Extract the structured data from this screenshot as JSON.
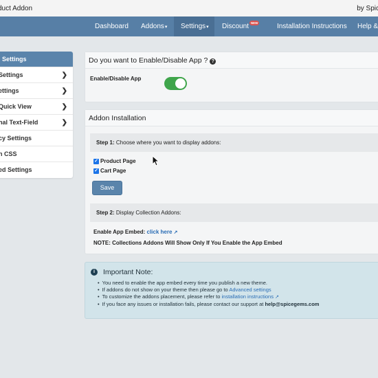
{
  "app": {
    "title": "duct Addon",
    "by": "by Spic"
  },
  "nav": {
    "dashboard": "Dashboard",
    "addons": "Addons",
    "settings": "Settings",
    "discount": "Discount",
    "discount_badge": "NEW",
    "installation": "Installation Instructions",
    "help": "Help &"
  },
  "sidebar": {
    "items": [
      {
        "label": "l Settings",
        "active": true,
        "chevron": false
      },
      {
        "label": "Settings",
        "chevron": true
      },
      {
        "label": "ettings",
        "chevron": true
      },
      {
        "label": "Quick View",
        "chevron": true
      },
      {
        "label": "nal Text-Field",
        "chevron": true
      },
      {
        "label": "cy Settings",
        "chevron": false
      },
      {
        "label": "n CSS",
        "chevron": false
      },
      {
        "label": "ed Settings",
        "chevron": false
      }
    ]
  },
  "enable_panel": {
    "title": "Do you want to Enable/Disable App ?",
    "label": "Enable/Disable App",
    "enabled": true
  },
  "install_panel": {
    "title": "Addon Installation",
    "step1_prefix": "Step 1:",
    "step1_text": "Choose where you want to display addons:",
    "checkboxes": [
      {
        "label": "Product Page",
        "checked": true
      },
      {
        "label": "Cart Page",
        "checked": true
      }
    ],
    "save_label": "Save",
    "step2_prefix": "Step 2:",
    "step2_text": "Display Collection Addons:",
    "embed_label": "Enable App Embed:",
    "embed_link": "click here",
    "note": "NOTE: Collections Addons Will Show Only If You Enable the App Embed"
  },
  "important_note": {
    "title": "Important Note:",
    "item1": "You need to enable the app embed every time you publish a new theme.",
    "item2_text": "If addons do not show on your theme then please go to",
    "item2_link": "Advanced settings",
    "item3_text": "To customize the addons placement, please refer to",
    "item3_link": "installation instructions",
    "item4_text": "If you face any issues or installation fails, please contact our support at",
    "item4_email": "help@spicegems.com"
  },
  "colors": {
    "nav_bg": "#577fa6",
    "sidebar_active": "#5a84ab",
    "toggle_on": "#3fa54b",
    "note_bg": "#d2e4ea",
    "link": "#2a6db5"
  }
}
